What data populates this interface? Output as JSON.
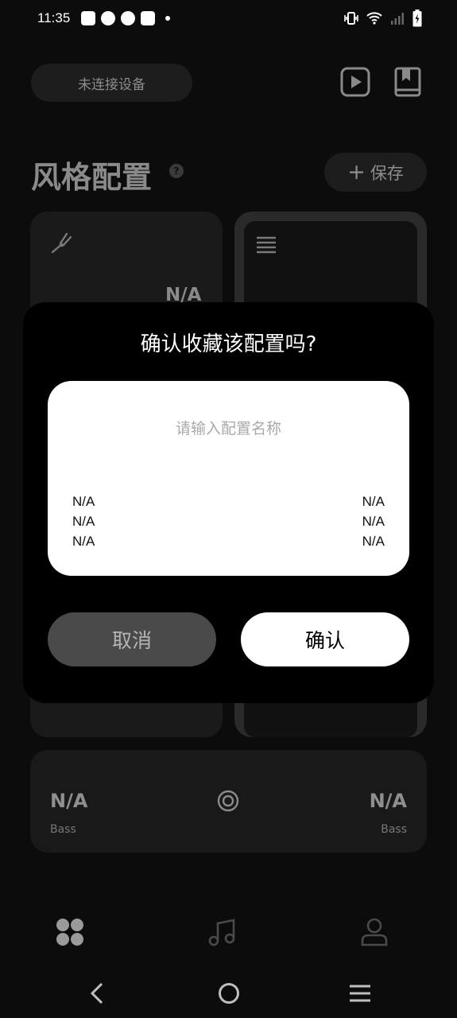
{
  "status_bar": {
    "time": "11:35",
    "left_icons": [
      "bag-icon",
      "speed-icon",
      "speed-icon",
      "bag-icon",
      "dot-icon"
    ],
    "right_icons": [
      "vibrate-icon",
      "wifi-icon",
      "signal-icon",
      "battery-charging-icon"
    ]
  },
  "header": {
    "connection_label": "未连接设备",
    "icons": [
      "play-square-icon",
      "book-icon"
    ]
  },
  "page": {
    "title": "风格配置",
    "help_glyph": "?",
    "save_plus": "+",
    "save_label": "保存"
  },
  "cards": {
    "left_value": "N/A"
  },
  "bottom_card": {
    "left_value": "N/A",
    "left_label": "Bass",
    "right_value": "N/A",
    "right_label": "Bass"
  },
  "tabbar": {
    "icons": [
      "grid-icon",
      "music-note-icon",
      "person-icon"
    ]
  },
  "navbar": {
    "icons": [
      "back-icon",
      "home-icon",
      "menu-icon"
    ]
  },
  "dialog": {
    "title": "确认收藏该配置吗?",
    "input_placeholder": "请输入配置名称",
    "input_value": "",
    "left_values": [
      "N/A",
      "N/A",
      "N/A"
    ],
    "right_values": [
      "N/A",
      "N/A",
      "N/A"
    ],
    "cancel_label": "取消",
    "confirm_label": "确认"
  },
  "colors": {
    "background": "#0c0c0c",
    "dialog_bg": "#000000",
    "confirm_bg": "#ffffff",
    "cancel_bg": "#4a4a4a"
  }
}
